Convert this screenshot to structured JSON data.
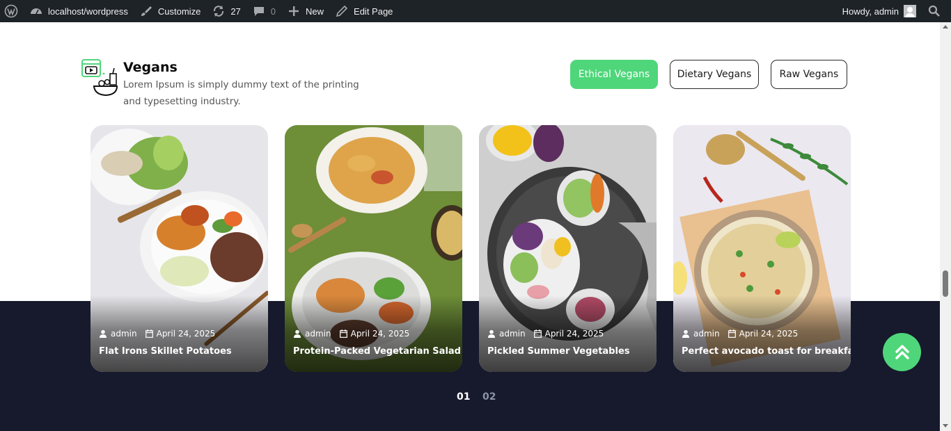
{
  "admin_bar": {
    "site": "localhost/wordpress",
    "customize": "Customize",
    "updates": "27",
    "comments": "0",
    "new": "New",
    "edit_page": "Edit Page",
    "howdy": "Howdy, admin"
  },
  "section": {
    "title": "Vegans",
    "description": "Lorem Ipsum is simply dummy text of the printing and typesetting industry."
  },
  "tabs": [
    {
      "label": "Ethical Vegans",
      "active": true
    },
    {
      "label": "Dietary Vegans",
      "active": false
    },
    {
      "label": "Raw Vegans",
      "active": false
    }
  ],
  "cards": [
    {
      "author": "admin",
      "date": "April 24, 2025",
      "title": "Flat Irons Skillet Potatoes"
    },
    {
      "author": "admin",
      "date": "April 24, 2025",
      "title": "Protein-Packed Vegetarian Salad"
    },
    {
      "author": "admin",
      "date": "April 24, 2025",
      "title": "Pickled Summer Vegetables"
    },
    {
      "author": "admin",
      "date": "April 24, 2025",
      "title": "Perfect avocado toast for breakfast"
    }
  ],
  "pagination": [
    "01",
    "02"
  ],
  "colors": {
    "accent": "#4fd67a",
    "dark_band": "#161a2c",
    "admin_bar": "#1d2327"
  }
}
